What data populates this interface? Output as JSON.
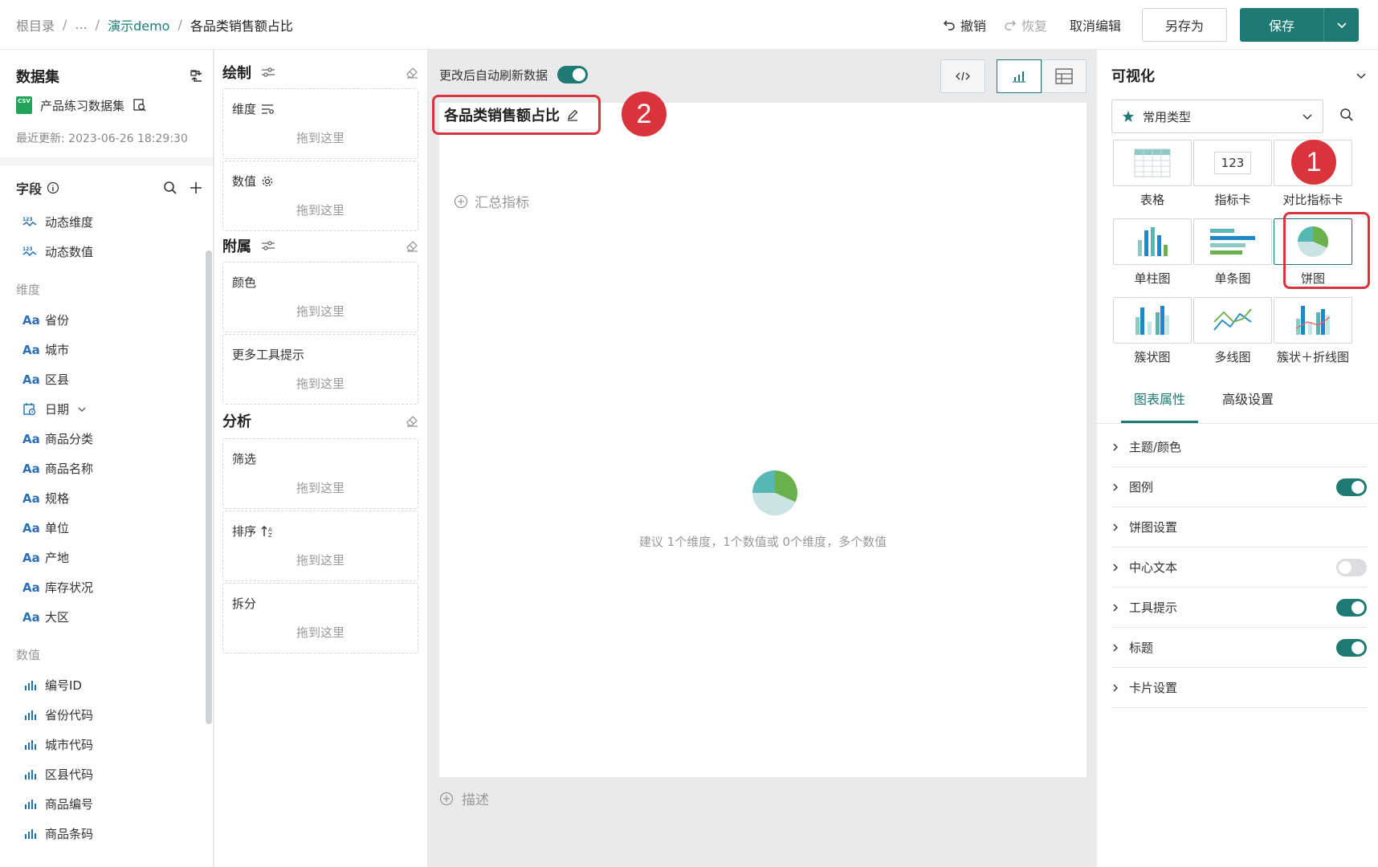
{
  "breadcrumb": {
    "root": "根目录",
    "ellipsis": "...",
    "folder": "演示demo",
    "current": "各品类销售额占比",
    "sep": "/"
  },
  "toolbar": {
    "undo": "撤销",
    "redo": "恢复",
    "cancel_edit": "取消编辑",
    "save_as": "另存为",
    "save": "保存"
  },
  "dataset": {
    "title": "数据集",
    "name": "产品练习数据集",
    "file_type": "CSV",
    "updated": "最近更新: 2023-06-26 18:29:30"
  },
  "fields": {
    "title": "字段",
    "dynamic": [
      {
        "icon": "dynamic-dimension-icon",
        "label": "动态维度"
      },
      {
        "icon": "dynamic-measure-icon",
        "label": "动态数值"
      }
    ],
    "dimension_label": "维度",
    "dimensions": [
      {
        "icon": "text-type-icon",
        "glyph": "Aa",
        "label": "省份"
      },
      {
        "icon": "text-type-icon",
        "glyph": "Aa",
        "label": "城市"
      },
      {
        "icon": "text-type-icon",
        "glyph": "Aa",
        "label": "区县"
      },
      {
        "icon": "date-type-icon",
        "glyph": "",
        "label": "日期"
      },
      {
        "icon": "text-type-icon",
        "glyph": "Aa",
        "label": "商品分类"
      },
      {
        "icon": "text-type-icon",
        "glyph": "Aa",
        "label": "商品名称"
      },
      {
        "icon": "text-type-icon",
        "glyph": "Aa",
        "label": "规格"
      },
      {
        "icon": "text-type-icon",
        "glyph": "Aa",
        "label": "单位"
      },
      {
        "icon": "text-type-icon",
        "glyph": "Aa",
        "label": "产地"
      },
      {
        "icon": "text-type-icon",
        "glyph": "Aa",
        "label": "库存状况"
      },
      {
        "icon": "text-type-icon",
        "glyph": "Aa",
        "label": "大区"
      }
    ],
    "measure_label": "数值",
    "measures": [
      {
        "icon": "number-type-icon",
        "label": "编号ID"
      },
      {
        "icon": "number-type-icon",
        "label": "省份代码"
      },
      {
        "icon": "number-type-icon",
        "label": "城市代码"
      },
      {
        "icon": "number-type-icon",
        "label": "区县代码"
      },
      {
        "icon": "number-type-icon",
        "label": "商品编号"
      },
      {
        "icon": "number-type-icon",
        "label": "商品条码"
      }
    ]
  },
  "config": {
    "draw": {
      "title": "绘制",
      "slots": [
        {
          "label": "维度",
          "hint": "拖到这里"
        },
        {
          "label": "数值",
          "hint": "拖到这里"
        }
      ]
    },
    "extra": {
      "title": "附属",
      "slots": [
        {
          "label": "颜色",
          "hint": "拖到这里"
        },
        {
          "label": "更多工具提示",
          "hint": "拖到这里"
        }
      ]
    },
    "analysis": {
      "title": "分析",
      "slots": [
        {
          "label": "筛选",
          "hint": "拖到这里"
        },
        {
          "label": "排序",
          "hint": "拖到这里"
        },
        {
          "label": "拆分",
          "hint": "拖到这里"
        }
      ]
    }
  },
  "canvas": {
    "auto_refresh": "更改后自动刷新数据",
    "chart_title": "各品类销售额占比",
    "add_metric": "汇总指标",
    "empty_tip": "建议 1个维度，1个数值或 0个维度，多个数值",
    "add_description": "描述",
    "annotation_2": "2"
  },
  "visualization": {
    "title": "可视化",
    "type_select": "常用类型",
    "annotation_1": "1",
    "chart_types": [
      {
        "id": "table",
        "label": "表格"
      },
      {
        "id": "kpi",
        "label": "指标卡",
        "preview_text": "123"
      },
      {
        "id": "compare-kpi",
        "label": "对比指标卡"
      },
      {
        "id": "column",
        "label": "单柱图"
      },
      {
        "id": "bar",
        "label": "单条图"
      },
      {
        "id": "pie",
        "label": "饼图",
        "selected": true
      },
      {
        "id": "cluster",
        "label": "簇状图"
      },
      {
        "id": "multiline",
        "label": "多线图"
      },
      {
        "id": "combo",
        "label": "簇状＋折线图"
      }
    ],
    "tabs": [
      {
        "label": "图表属性",
        "active": true
      },
      {
        "label": "高级设置"
      }
    ],
    "properties": [
      {
        "label": "主题/颜色"
      },
      {
        "label": "图例",
        "toggle": "on"
      },
      {
        "label": "饼图设置"
      },
      {
        "label": "中心文本",
        "toggle": "off"
      },
      {
        "label": "工具提示",
        "toggle": "on"
      },
      {
        "label": "标题",
        "toggle": "on"
      },
      {
        "label": "卡片设置"
      }
    ]
  },
  "colors": {
    "accent": "#1e7a73",
    "annotation_red": "#d9343b",
    "pie_green": "#6ab04c",
    "pie_teal": "#56b7b3",
    "pie_light": "#c9e4e2"
  }
}
